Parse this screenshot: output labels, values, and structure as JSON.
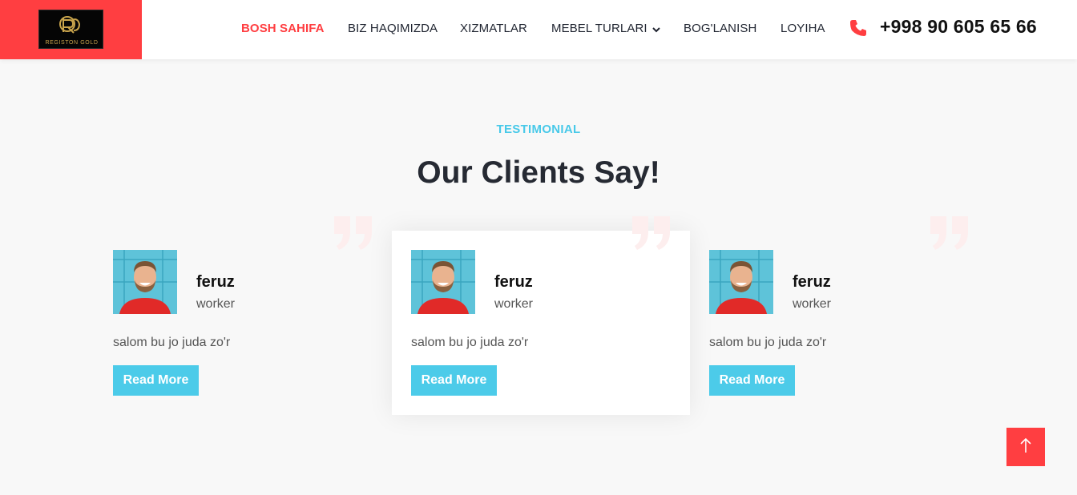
{
  "header": {
    "logo_text": "REGISTON GOLD",
    "nav": [
      {
        "label": "BOSH SAHIFA",
        "active": true
      },
      {
        "label": "BIZ HAQIMIZDA",
        "active": false
      },
      {
        "label": "XIZMATLAR",
        "active": false
      },
      {
        "label": "MEBEL TURLARI",
        "active": false,
        "has_dropdown": true
      },
      {
        "label": "BOG'LANISH",
        "active": false
      },
      {
        "label": "LOYIHA",
        "active": false
      }
    ],
    "phone": "+998 90 605 65 66",
    "phone_icon": "phone-icon",
    "dropdown_icon": "chevron-down-icon"
  },
  "section": {
    "eyebrow": "TESTIMONIAL",
    "title": "Our Clients Say!"
  },
  "testimonials": [
    {
      "name": "feruz",
      "role": "worker",
      "text": "salom bu jo juda zo'r",
      "button": "Read More",
      "featured": false
    },
    {
      "name": "feruz",
      "role": "worker",
      "text": "salom bu jo juda zo'r",
      "button": "Read More",
      "featured": true
    },
    {
      "name": "feruz",
      "role": "worker",
      "text": "salom bu jo juda zo'r",
      "button": "Read More",
      "featured": false
    }
  ],
  "back_to_top_icon": "arrow-up-icon",
  "colors": {
    "accent_red": "#ff3e41",
    "accent_cyan": "#4ccbe9",
    "heading": "#262a33",
    "background": "#f8f8f8"
  }
}
